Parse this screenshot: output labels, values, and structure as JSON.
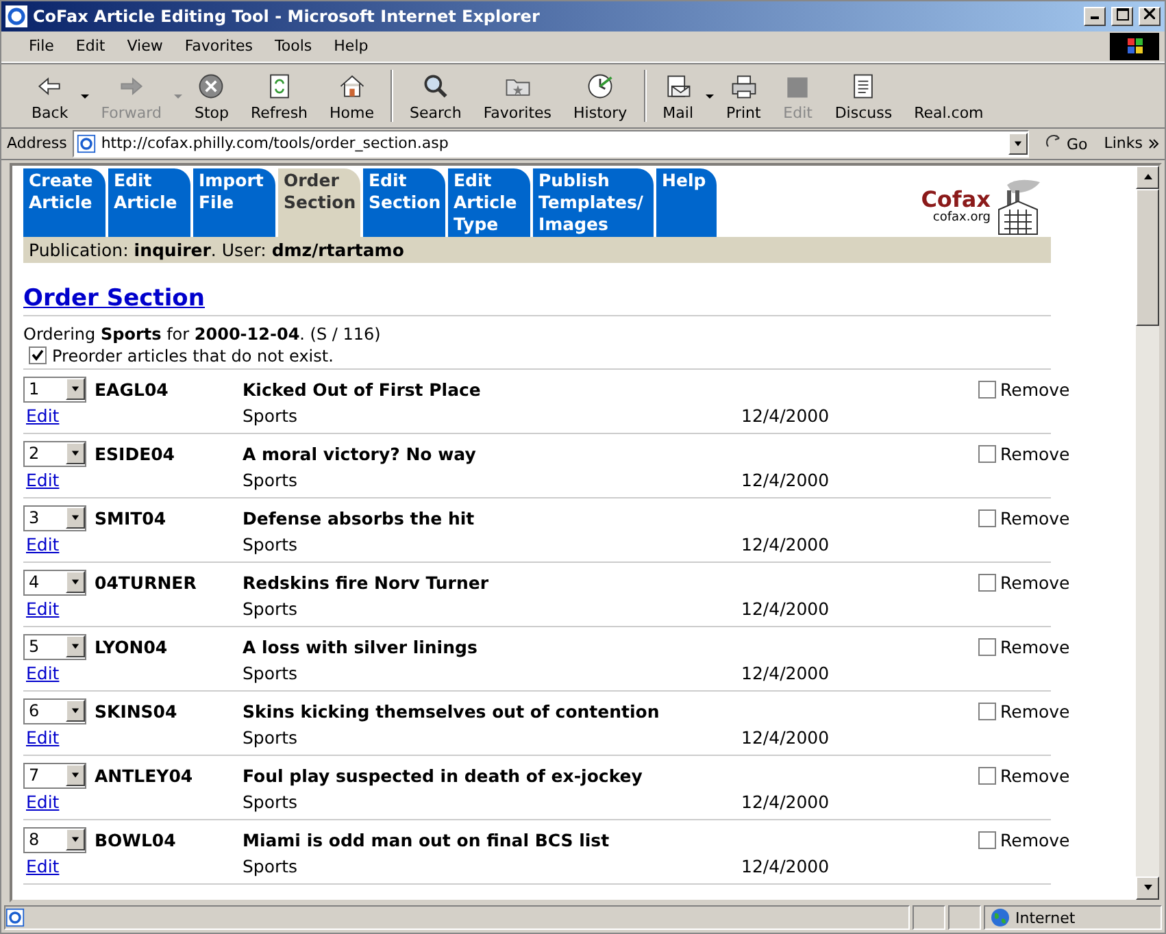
{
  "window": {
    "title": "CoFax Article Editing Tool - Microsoft Internet Explorer"
  },
  "menu": [
    "File",
    "Edit",
    "View",
    "Favorites",
    "Tools",
    "Help"
  ],
  "toolbar": [
    {
      "kind": "back",
      "label": "Back",
      "disabled": false,
      "dropdown": true
    },
    {
      "kind": "forward",
      "label": "Forward",
      "disabled": true,
      "dropdown": true
    },
    {
      "kind": "stop",
      "label": "Stop",
      "disabled": false,
      "dropdown": false
    },
    {
      "kind": "refresh",
      "label": "Refresh",
      "disabled": false,
      "dropdown": false
    },
    {
      "kind": "home",
      "label": "Home",
      "disabled": false,
      "dropdown": false
    },
    {
      "kind": "search",
      "label": "Search",
      "disabled": false,
      "dropdown": false
    },
    {
      "kind": "favorites",
      "label": "Favorites",
      "disabled": false,
      "dropdown": false
    },
    {
      "kind": "history",
      "label": "History",
      "disabled": false,
      "dropdown": false
    },
    {
      "kind": "mail",
      "label": "Mail",
      "disabled": false,
      "dropdown": true
    },
    {
      "kind": "print",
      "label": "Print",
      "disabled": false,
      "dropdown": false
    },
    {
      "kind": "edit",
      "label": "Edit",
      "disabled": true,
      "dropdown": false
    },
    {
      "kind": "discuss",
      "label": "Discuss",
      "disabled": false,
      "dropdown": false
    },
    {
      "kind": "text",
      "label": "Real.com",
      "disabled": false,
      "dropdown": false
    }
  ],
  "address_bar": {
    "label": "Address",
    "url": "http://cofax.philly.com/tools/order_section.asp",
    "go": "Go",
    "links": "Links"
  },
  "tabs": [
    {
      "label": "Create Article",
      "selected": false
    },
    {
      "label": "Edit Article",
      "selected": false
    },
    {
      "label": "Import File",
      "selected": false
    },
    {
      "label": "Order Section",
      "selected": true
    },
    {
      "label": "Edit Section",
      "selected": false
    },
    {
      "label": "Edit Article Type",
      "selected": false
    },
    {
      "label": "Publish Templates/ Images",
      "selected": false
    },
    {
      "label": "Help",
      "selected": false
    }
  ],
  "publication_line": "Publication: **inquirer**. User: **dmz/rtartamo**",
  "logo": {
    "name": "Cofax",
    "site": "cofax.org"
  },
  "heading": "Order Section",
  "ordering_line": "Ordering **Sports** for **2000-12-04**. (S / 116)",
  "preorder": {
    "label": "Preorder articles that do not exist.",
    "checked": true
  },
  "articles": [
    {
      "order": "1",
      "code": "EAGL04",
      "title": "Kicked Out of First Place",
      "edit": "Edit",
      "section": "Sports",
      "date": "12/4/2000",
      "remove": "Remove",
      "removed": false
    },
    {
      "order": "2",
      "code": "ESIDE04",
      "title": "A moral victory? No way",
      "edit": "Edit",
      "section": "Sports",
      "date": "12/4/2000",
      "remove": "Remove",
      "removed": false
    },
    {
      "order": "3",
      "code": "SMIT04",
      "title": "Defense absorbs the hit",
      "edit": "Edit",
      "section": "Sports",
      "date": "12/4/2000",
      "remove": "Remove",
      "removed": false
    },
    {
      "order": "4",
      "code": "04TURNER",
      "title": "Redskins fire Norv Turner",
      "edit": "Edit",
      "section": "Sports",
      "date": "12/4/2000",
      "remove": "Remove",
      "removed": false
    },
    {
      "order": "5",
      "code": "LYON04",
      "title": "A loss with silver linings",
      "edit": "Edit",
      "section": "Sports",
      "date": "12/4/2000",
      "remove": "Remove",
      "removed": false
    },
    {
      "order": "6",
      "code": "SKINS04",
      "title": "Skins kicking themselves out of contention",
      "edit": "Edit",
      "section": "Sports",
      "date": "12/4/2000",
      "remove": "Remove",
      "removed": false
    },
    {
      "order": "7",
      "code": "ANTLEY04",
      "title": "Foul play suspected in death of ex-jockey",
      "edit": "Edit",
      "section": "Sports",
      "date": "12/4/2000",
      "remove": "Remove",
      "removed": false
    },
    {
      "order": "8",
      "code": "BOWL04",
      "title": "Miami is odd man out on final BCS list",
      "edit": "Edit",
      "section": "Sports",
      "date": "12/4/2000",
      "remove": "Remove",
      "removed": false
    }
  ],
  "status_bar": {
    "zone": "Internet"
  }
}
